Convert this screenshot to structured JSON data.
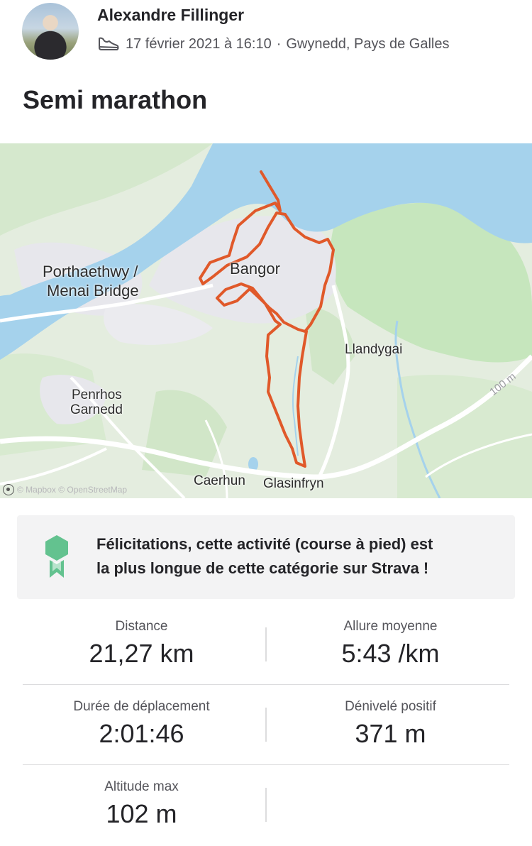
{
  "header": {
    "athlete_name": "Alexandre Fillinger",
    "activity_icon": "running-shoe-icon",
    "date_time": "17 février 2021 à 16:10",
    "separator": "·",
    "location": "Gwynedd, Pays de Galles"
  },
  "activity": {
    "title": "Semi marathon"
  },
  "map": {
    "labels": {
      "menai_1": "Porthaethwy /",
      "menai_2": "Menai Bridge",
      "bangor": "Bangor",
      "llandygai": "Llandygai",
      "penrhos_1": "Penrhos",
      "penrhos_2": "Garnedd",
      "caerhun": "Caerhun",
      "glasinfryn": "Glasinfryn",
      "elevation": "100 m"
    },
    "attribution": "© Mapbox © OpenStreetMap",
    "colors": {
      "route": "#e0592a",
      "water": "#a5d2ec",
      "land": "#e4eddf",
      "park": "#c6e6bd",
      "urban": "#e7e7ec"
    }
  },
  "achievement": {
    "icon": "achievement-badge-icon",
    "line1": "Félicitations, cette activité (course à pied) est",
    "line2": "la plus longue de cette catégorie sur Strava !",
    "badge_color": "#63c28f"
  },
  "stats": {
    "distance": {
      "label": "Distance",
      "value": "21,27 km"
    },
    "pace": {
      "label": "Allure moyenne",
      "value": "5:43 /km"
    },
    "moving_time": {
      "label": "Durée de déplacement",
      "value": "2:01:46"
    },
    "elevation_gain": {
      "label": "Dénivelé positif",
      "value": "371 m"
    },
    "max_elevation": {
      "label": "Altitude max",
      "value": "102 m"
    }
  }
}
